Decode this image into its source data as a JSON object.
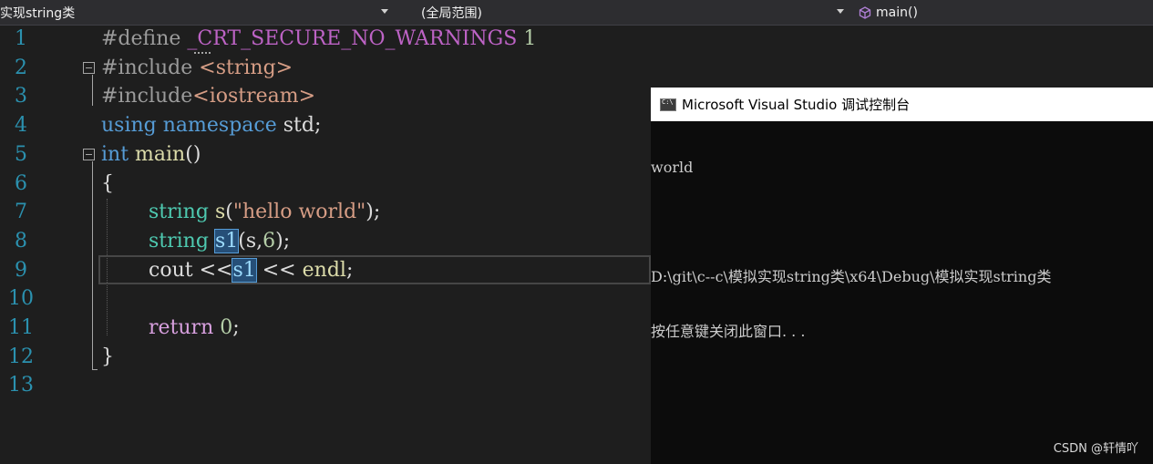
{
  "navbar": {
    "project": "实现string类",
    "scope": "(全局范围)",
    "member": "main()",
    "member_icon": "cube-icon"
  },
  "editor": {
    "line_numbers": [
      "1",
      "2",
      "3",
      "4",
      "5",
      "6",
      "7",
      "8",
      "9",
      "10",
      "11",
      "12",
      "13"
    ],
    "lines": {
      "l1_define": "#define",
      "l1_macro": "_CRT_SECURE_NO_WARNINGS",
      "l1_num": "1",
      "l2_directive": "#include",
      "l2_header": "<string>",
      "l3_directive": "#include",
      "l3_header": "<iostream>",
      "l4_using": "using",
      "l4_namespace": "namespace",
      "l4_std": "std;",
      "l5_int": "int",
      "l5_main": "main",
      "l5_parens": "()",
      "l6_open": "{",
      "l7_type": "string",
      "l7_var": "s",
      "l7_open": "(",
      "l7_str": "\"hello world\"",
      "l7_close": ");",
      "l8_type": "string",
      "l8_var": "s1",
      "l8_open": "(",
      "l8_arg": "s",
      "l8_comma": ",",
      "l8_num": "6",
      "l8_close": ");",
      "l9_cout": "cout",
      "l9_op1": "<<",
      "l9_var": "s1",
      "l9_op2": "<<",
      "l9_endl": "endl",
      "l9_end": ";",
      "l11_return": "return",
      "l11_num": "0",
      "l11_end": ";",
      "l12_close": "}"
    }
  },
  "console": {
    "title": "Microsoft Visual Studio 调试控制台",
    "icon": "console-app-icon",
    "output": [
      "world",
      "",
      "D:\\git\\c--c\\模拟实现string类\\x64\\Debug\\模拟实现string类",
      "按任意键关闭此窗口. . ."
    ]
  },
  "watermark": "CSDN @轩情吖",
  "colors": {
    "editor_bg": "#1e1e1e",
    "keyword": "#569cd6",
    "control_keyword": "#d8a0df",
    "type": "#4ec9b0",
    "string": "#d69d85",
    "line_number": "#2b91af",
    "selection": "#264f78"
  }
}
